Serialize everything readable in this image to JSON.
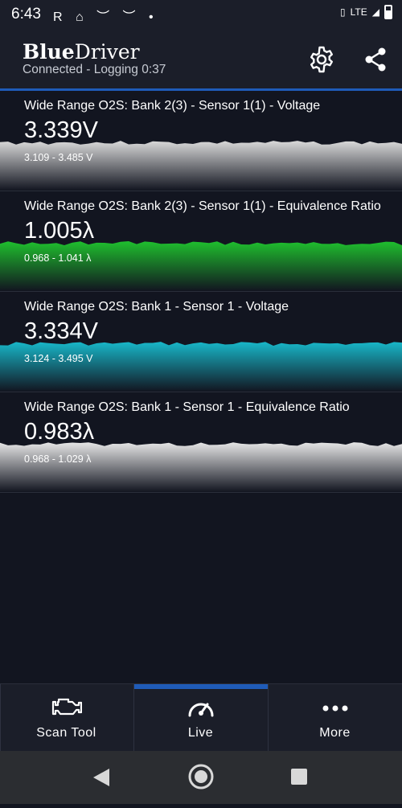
{
  "status_bar": {
    "time": "6:43",
    "notifications": "R ⌂ ︶ ︶ •",
    "network": "LTE"
  },
  "app": {
    "brand_bold": "Blue",
    "brand_regular": "Driver",
    "subtitle": "Connected - Logging 0:37"
  },
  "sensors": [
    {
      "title": "Wide Range O2S: Bank 2(3) - Sensor 1(1) - Voltage",
      "value": "3.339V",
      "range": "3.109 - 3.485 V",
      "color": "#d9d9d9"
    },
    {
      "title": "Wide Range O2S: Bank 2(3) - Sensor 1(1) - Equivalence Ratio",
      "value": "1.005λ",
      "range": "0.968 - 1.041 λ",
      "color": "#1fbf2e"
    },
    {
      "title": "Wide Range O2S: Bank 1 - Sensor 1 - Voltage",
      "value": "3.334V",
      "range": "3.124 - 3.495 V",
      "color": "#18b7c9"
    },
    {
      "title": "Wide Range O2S: Bank 1 - Sensor 1 - Equivalence Ratio",
      "value": "0.983λ",
      "range": "0.968 - 1.029 λ",
      "color": "#e6e6e6"
    }
  ],
  "bottom_nav": {
    "items": [
      {
        "label": "Scan Tool",
        "icon": "engine-icon"
      },
      {
        "label": "Live",
        "icon": "gauge-icon",
        "active": true
      },
      {
        "label": "More",
        "icon": "more-dots-icon"
      }
    ]
  },
  "colors": {
    "accent": "#1f5bb8",
    "background": "#121520",
    "bar": "#1b1e29"
  }
}
